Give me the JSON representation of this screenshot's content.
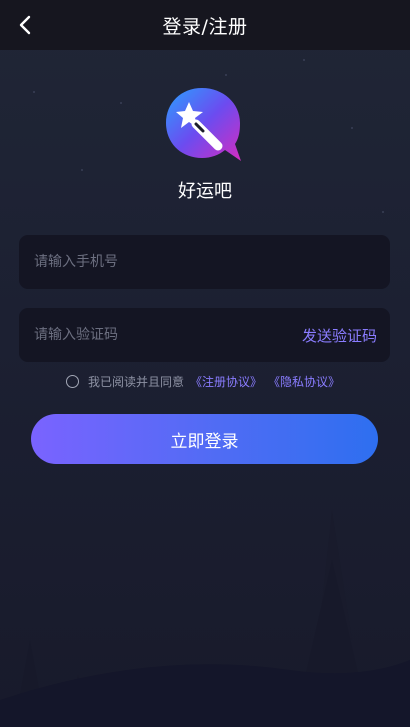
{
  "header": {
    "title": "登录/注册",
    "back_icon": "chevron-left-icon"
  },
  "app": {
    "name": "好运吧",
    "logo_icon": "magic-wand-chat-icon"
  },
  "form": {
    "phone": {
      "placeholder": "请输入手机号",
      "value": ""
    },
    "code": {
      "placeholder": "请输入验证码",
      "value": ""
    },
    "send_code_label": "发送验证码"
  },
  "agreement": {
    "checked": false,
    "text": "我已阅读并且同意",
    "register_link": "《注册协议》",
    "privacy_link": "《隐私协议》"
  },
  "login_button": {
    "label": "立即登录"
  },
  "colors": {
    "accent": "#8a7cff",
    "button_start": "#7a63ff",
    "button_end": "#2e6ff0",
    "background": "#1c2032"
  }
}
